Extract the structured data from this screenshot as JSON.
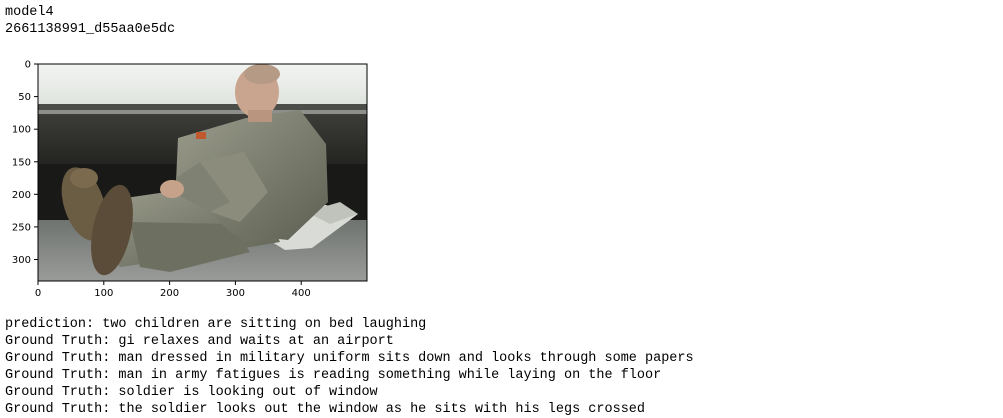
{
  "header": {
    "model": "model4",
    "image_id": "2661138991_d55aa0e5dc"
  },
  "plot": {
    "image_content": "photo of a soldier in camouflage uniform sitting on the floor near a window",
    "x_axis": {
      "range": [
        0,
        500
      ],
      "ticks": [
        0,
        100,
        200,
        300,
        400
      ],
      "tick_labels": [
        "0",
        "100",
        "200",
        "300",
        "400"
      ]
    },
    "y_axis": {
      "range": [
        0,
        333
      ],
      "ticks": [
        0,
        50,
        100,
        150,
        200,
        250,
        300
      ],
      "tick_labels": [
        "0",
        "50",
        "100",
        "150",
        "200",
        "250",
        "300"
      ]
    }
  },
  "captions": [
    "prediction: two children are sitting on bed laughing",
    "Ground Truth: gi relaxes and waits at an airport",
    "Ground Truth: man dressed in military uniform sits down and looks through some papers",
    "Ground Truth: man in army fatigues is reading something while laying on the floor",
    "Ground Truth: soldier is looking out of window",
    "Ground Truth: the soldier looks out the window as he sits with his legs crossed"
  ]
}
